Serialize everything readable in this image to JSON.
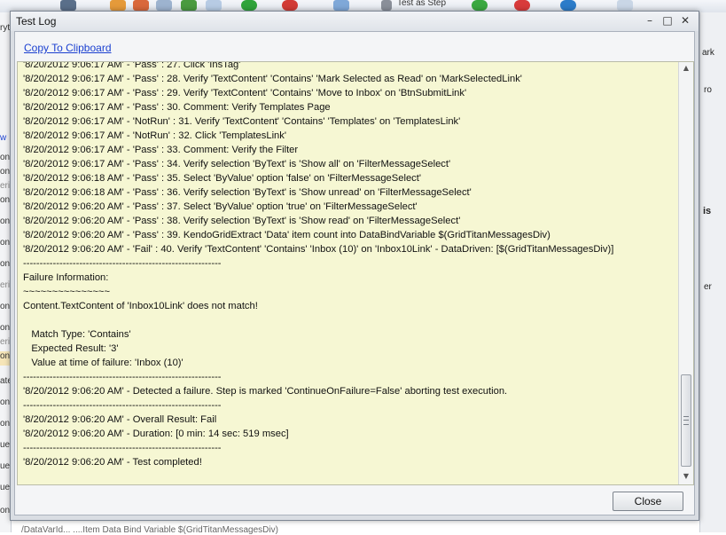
{
  "background_app": {
    "toolbar_label": "Test as Step",
    "left_items": [
      "ryt",
      "",
      "",
      "",
      "",
      "",
      "",
      "",
      "w",
      "on",
      "on",
      "eri",
      "on",
      "on",
      "on",
      "on",
      "eri",
      "on",
      "ate",
      "on",
      "on",
      "ue",
      "ue",
      "ue",
      "on"
    ],
    "right_texts": [
      "ark",
      "ro",
      "is",
      "er"
    ],
    "bottom_text": "/DataVarId... ....Item Data Bind Variable $(GridTitanMessagesDiv)"
  },
  "window": {
    "title": "Test Log",
    "controls": {
      "minimize": "–",
      "maximize": "□",
      "close": "✕"
    }
  },
  "copy_link": "Copy To Clipboard",
  "log_lines": [
    "'8/20/2012 9:06:17 AM' - 'Pass' : 27. Click 'InsTag'",
    "'8/20/2012 9:06:17 AM' - 'Pass' : 28. Verify 'TextContent' 'Contains' 'Mark Selected as Read' on 'MarkSelectedLink'",
    "'8/20/2012 9:06:17 AM' - 'Pass' : 29. Verify 'TextContent' 'Contains' 'Move to Inbox' on 'BtnSubmitLink'",
    "'8/20/2012 9:06:17 AM' - 'Pass' : 30. Comment: Verify Templates Page",
    "'8/20/2012 9:06:17 AM' - 'NotRun' : 31. Verify 'TextContent' 'Contains' 'Templates' on 'TemplatesLink'",
    "'8/20/2012 9:06:17 AM' - 'NotRun' : 32. Click 'TemplatesLink'",
    "'8/20/2012 9:06:17 AM' - 'Pass' : 33. Comment: Verify the Filter",
    "'8/20/2012 9:06:17 AM' - 'Pass' : 34. Verify selection 'ByText' is 'Show all' on 'FilterMessageSelect'",
    "'8/20/2012 9:06:18 AM' - 'Pass' : 35. Select 'ByValue' option 'false' on 'FilterMessageSelect'",
    "'8/20/2012 9:06:18 AM' - 'Pass' : 36. Verify selection 'ByText' is 'Show unread' on 'FilterMessageSelect'",
    "'8/20/2012 9:06:20 AM' - 'Pass' : 37. Select 'ByValue' option 'true' on 'FilterMessageSelect'",
    "'8/20/2012 9:06:20 AM' - 'Pass' : 38. Verify selection 'ByText' is 'Show read' on 'FilterMessageSelect'",
    "'8/20/2012 9:06:20 AM' - 'Pass' : 39. KendoGridExtract 'Data' item count into DataBindVariable $(GridTitanMessagesDiv)",
    "'8/20/2012 9:06:20 AM' - 'Fail' : 40. Verify 'TextContent' 'Contains' 'Inbox (10)' on 'Inbox10Link' - DataDriven: [$(GridTitanMessagesDiv)]",
    "------------------------------------------------------------",
    "Failure Information:",
    "~~~~~~~~~~~~~~~",
    "Content.TextContent of 'Inbox10Link' does not match!",
    "",
    "   Match Type: 'Contains'",
    "   Expected Result: '3'",
    "   Value at time of failure: 'Inbox (10)'",
    "------------------------------------------------------------",
    "'8/20/2012 9:06:20 AM' - Detected a failure. Step is marked 'ContinueOnFailure=False' aborting test execution.",
    "------------------------------------------------------------",
    "'8/20/2012 9:06:20 AM' - Overall Result: Fail",
    "'8/20/2012 9:06:20 AM' - Duration: [0 min: 14 sec: 519 msec]",
    "------------------------------------------------------------",
    "'8/20/2012 9:06:20 AM' - Test completed!"
  ],
  "scrollbar": {
    "up_arrow": "▲",
    "down_arrow": "▼"
  },
  "close_button": "Close"
}
